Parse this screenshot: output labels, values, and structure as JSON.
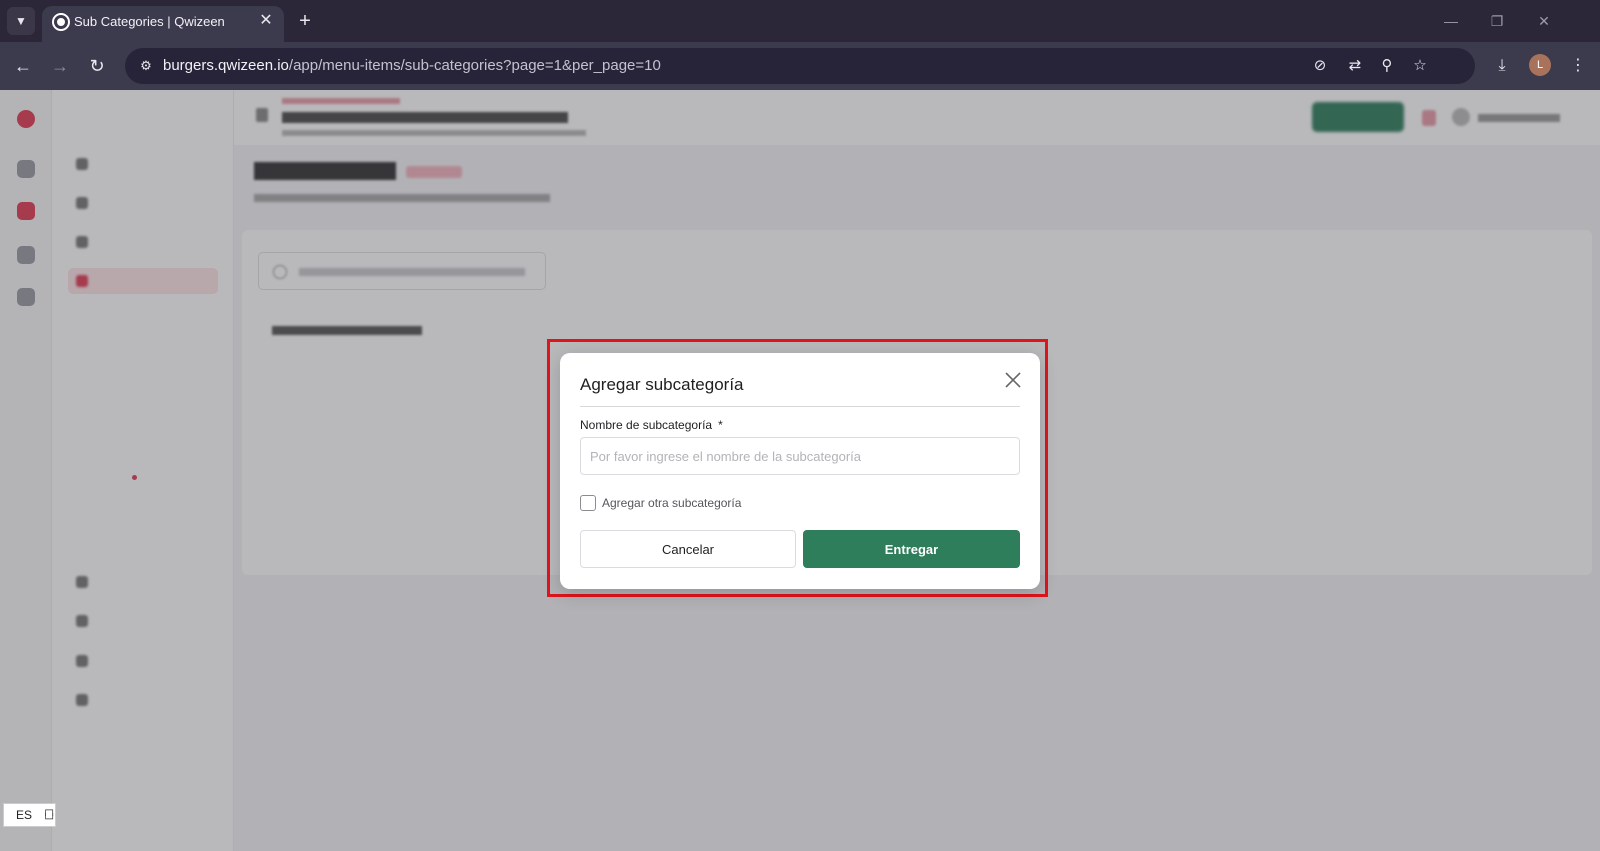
{
  "browser": {
    "tab_title": "Sub Categories | Qwizeen",
    "url_host": "burgers.qwizeen.io",
    "url_path": "/app/menu-items/sub-categories?page=1&per_page=10",
    "profile_initial": "L",
    "icons": [
      "chevron-down-icon",
      "favicon-icon",
      "close-icon",
      "plus-icon",
      "back-icon",
      "forward-icon",
      "reload-icon",
      "site-info-icon",
      "eye-off-icon",
      "translate-icon",
      "zoom-icon",
      "star-icon",
      "download-icon",
      "more-icon"
    ]
  },
  "modal": {
    "title": "Agregar subcategoría",
    "field_label": "Nombre de subcategoría",
    "required_mark": "*",
    "field_value": "",
    "field_placeholder": "Por favor ingrese el nombre de la subcategoría",
    "checkbox_label": "Agregar otra subcategoría",
    "checkbox_checked": false,
    "cancel_label": "Cancelar",
    "submit_label": "Entregar"
  },
  "language_widget": {
    "code": "ES"
  },
  "colors": {
    "primary_green": "#2e7d5b",
    "highlight_red": "#e0141c",
    "brand_red": "#e23b52"
  }
}
